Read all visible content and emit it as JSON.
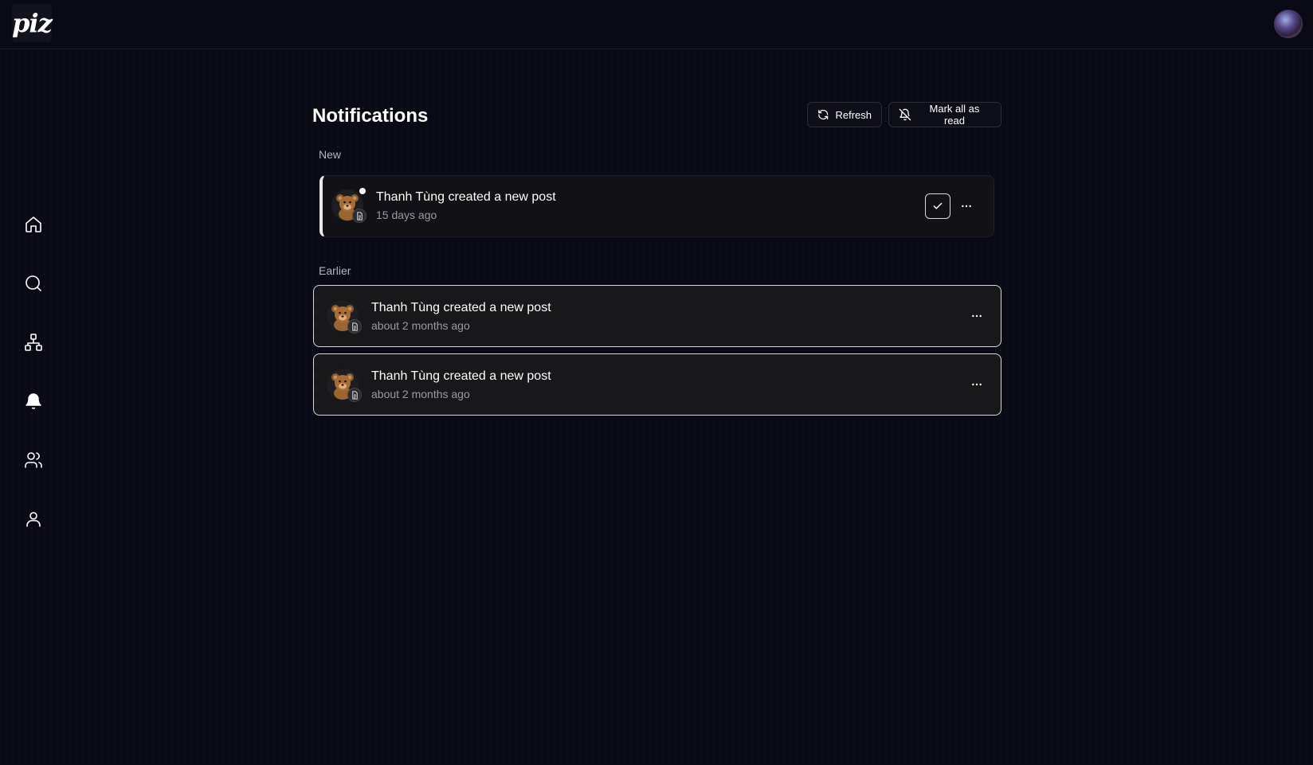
{
  "app": {
    "logo_text": "piz"
  },
  "header": {
    "avatar_icon": "user-avatar"
  },
  "sidebar": {
    "items": [
      {
        "name": "home",
        "icon": "home-icon"
      },
      {
        "name": "search",
        "icon": "search-icon"
      },
      {
        "name": "network",
        "icon": "network-icon"
      },
      {
        "name": "notifications",
        "icon": "bell-icon",
        "active": true
      },
      {
        "name": "people",
        "icon": "users-icon"
      },
      {
        "name": "profile",
        "icon": "user-icon"
      }
    ]
  },
  "page": {
    "title": "Notifications",
    "refresh_label": "Refresh",
    "mark_all_label": "Mark all as read"
  },
  "sections": {
    "new_label": "New",
    "earlier_label": "Earlier"
  },
  "notifications": {
    "new": [
      {
        "title": "Thanh Tùng created a new post",
        "time": "15 days ago",
        "unread": true
      }
    ],
    "earlier": [
      {
        "title": "Thanh Tùng created a new post",
        "time": "about 2 months ago"
      },
      {
        "title": "Thanh Tùng created a new post",
        "time": "about 2 months ago"
      }
    ]
  },
  "colors": {
    "background": "#0a0a16",
    "card": "#18181b",
    "text": "#ffffff",
    "muted": "#9a9aa4"
  }
}
